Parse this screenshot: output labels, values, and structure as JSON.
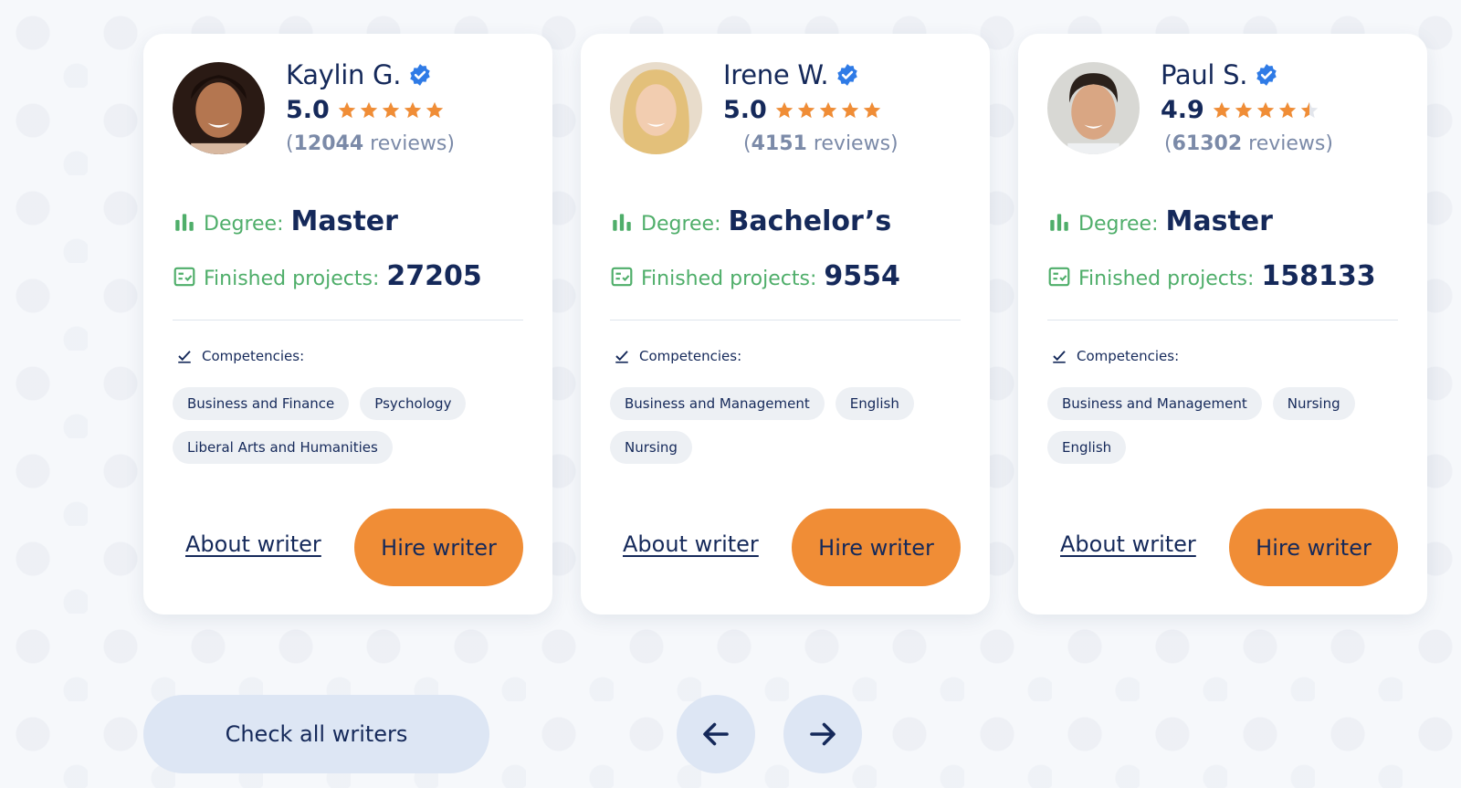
{
  "colors": {
    "accent": "#f08d36",
    "navy": "#15295a",
    "green": "#4fae6a",
    "verified": "#2f7be6",
    "star": "#f08d36"
  },
  "writers": [
    {
      "name": "Kaylin G.",
      "rating": "5.0",
      "stars": 5,
      "reviews_open": "(",
      "reviews_count": "12044",
      "reviews_label": " reviews)",
      "degree_label": "Degree:",
      "degree_value": "Master",
      "projects_label": "Finished projects:",
      "projects_value": "27205",
      "competencies_label": "Competencies:",
      "tags": [
        "Business and Finance",
        "Psychology",
        "Liberal Arts and Humanities"
      ],
      "about_label": "About writer",
      "hire_label": "Hire writer"
    },
    {
      "name": "Irene W.",
      "rating": "5.0",
      "stars": 5,
      "reviews_open": "(",
      "reviews_count": "4151",
      "reviews_label": " reviews)",
      "degree_label": "Degree:",
      "degree_value": "Bachelor’s",
      "projects_label": "Finished projects:",
      "projects_value": "9554",
      "competencies_label": "Competencies:",
      "tags": [
        "Business and Management",
        "English",
        "Nursing"
      ],
      "about_label": "About writer",
      "hire_label": "Hire writer"
    },
    {
      "name": "Paul S.",
      "rating": "4.9",
      "stars": 4.5,
      "reviews_open": "(",
      "reviews_count": "61302",
      "reviews_label": " reviews)",
      "degree_label": "Degree:",
      "degree_value": "Master",
      "projects_label": "Finished projects:",
      "projects_value": "158133",
      "competencies_label": "Competencies:",
      "tags": [
        "Business and Management",
        "Nursing",
        "English"
      ],
      "about_label": "About writer",
      "hire_label": "Hire writer"
    }
  ],
  "footer": {
    "check_all_label": "Check all writers",
    "prev_icon": "arrow-left-icon",
    "next_icon": "arrow-right-icon"
  }
}
